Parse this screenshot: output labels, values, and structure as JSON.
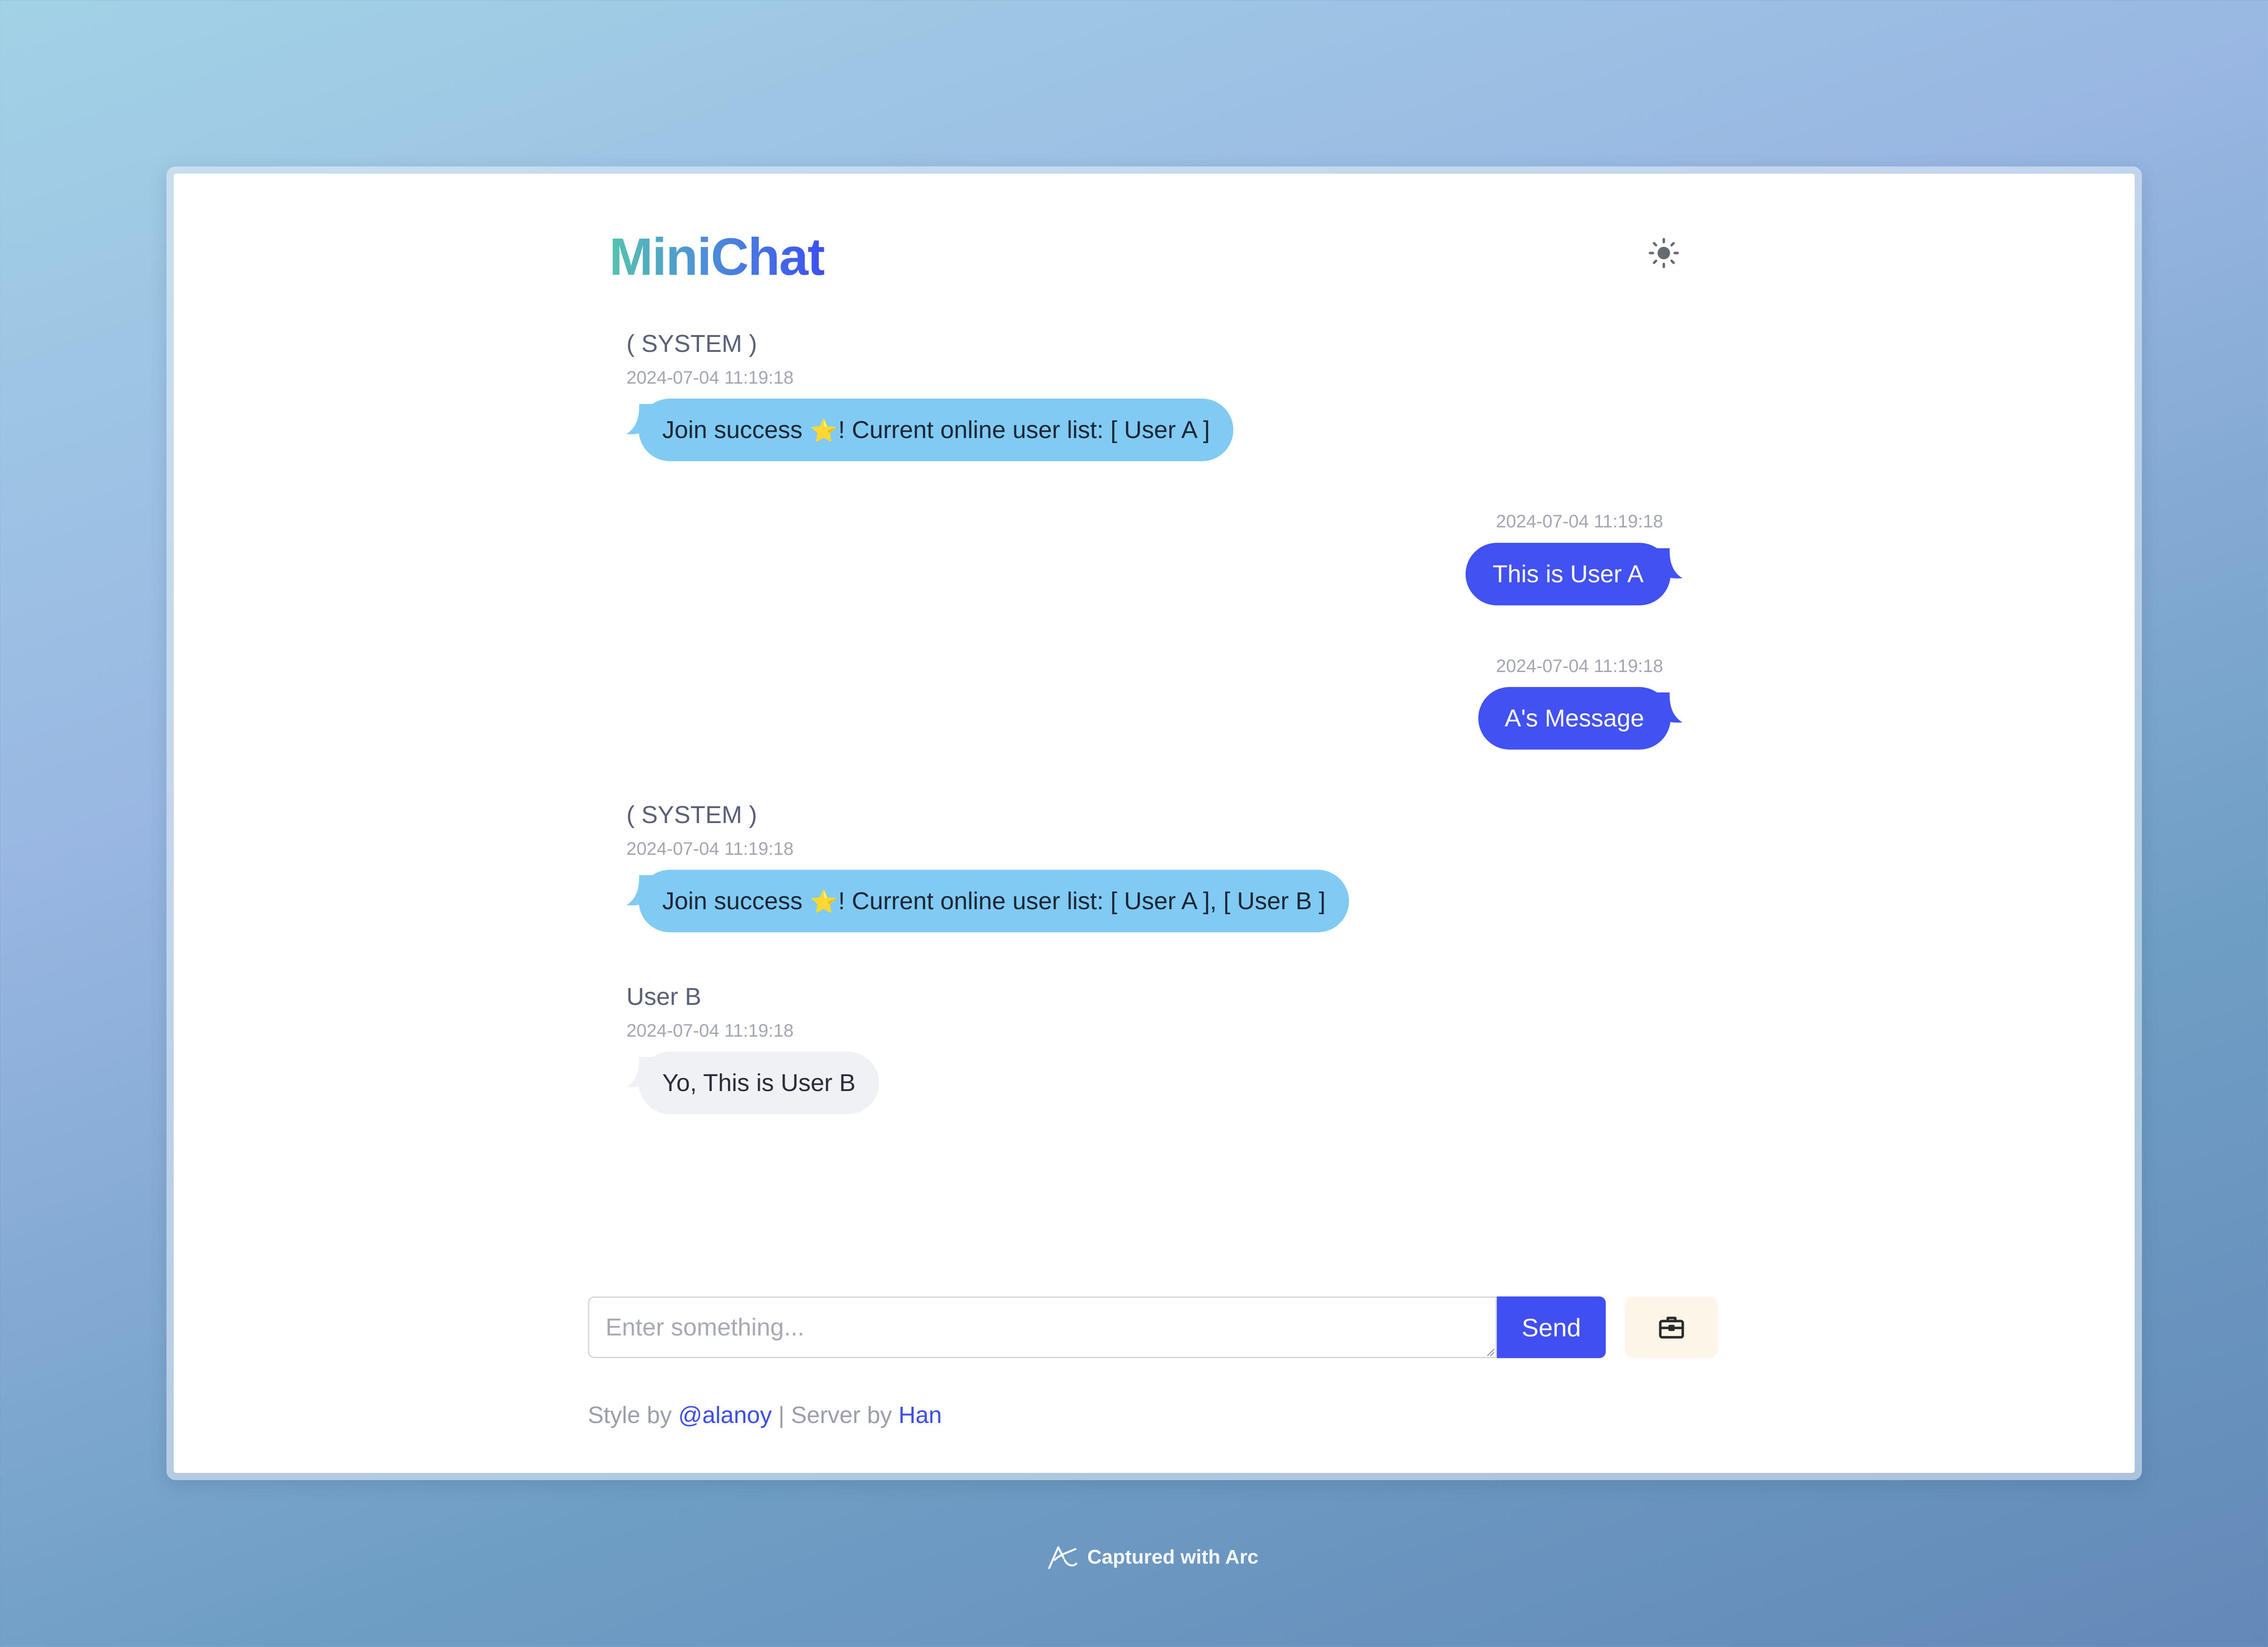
{
  "app": {
    "logo": "MiniChat"
  },
  "messages": [
    {
      "sender": "( SYSTEM )",
      "time": "2024-07-04 11:19:18",
      "text_before": "Join success ",
      "star": "⭐",
      "text_after": "! Current online user list: [ User A ]",
      "type": "system"
    },
    {
      "time": "2024-07-04 11:19:18",
      "text": "This is User A",
      "type": "self"
    },
    {
      "time": "2024-07-04 11:19:18",
      "text": "A's Message",
      "type": "self"
    },
    {
      "sender": "( SYSTEM )",
      "time": "2024-07-04 11:19:18",
      "text_before": "Join success ",
      "star": "⭐",
      "text_after": "! Current online user list: [ User A ], [ User B ]",
      "type": "system"
    },
    {
      "sender": "User B",
      "time": "2024-07-04 11:19:18",
      "text": "Yo, This is User B",
      "type": "other"
    }
  ],
  "composer": {
    "placeholder": "Enter something...",
    "value": "",
    "send_label": "Send"
  },
  "footer": {
    "style_prefix": "Style by ",
    "style_link": "@alanoy",
    "separator": " |  ",
    "server_prefix": "Server by ",
    "server_link": "Han"
  },
  "capture_badge": "Captured with Arc",
  "icons": {
    "theme": "sun-icon",
    "tool": "toolbox-icon",
    "capture": "arc-logo-icon"
  },
  "colors": {
    "system_bubble": "#7fcbf4",
    "self_bubble": "#4251f2",
    "other_bubble": "#f0f1f4",
    "accent": "#3f4ff1"
  }
}
